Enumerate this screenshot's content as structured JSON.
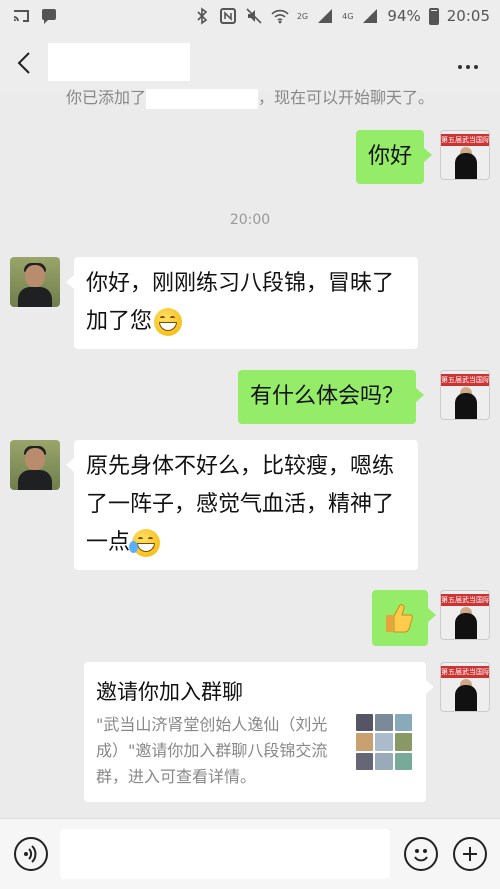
{
  "status_bar": {
    "battery_percent": "94%",
    "time": "20:05",
    "signal_labels": [
      "2G",
      "4G"
    ]
  },
  "header": {
    "back_icon": "chevron-left-icon",
    "more_icon": "ellipsis-icon"
  },
  "system_note": {
    "prefix": "你已添加了",
    "suffix": "，现在可以开始聊天了。"
  },
  "messages": [
    {
      "side": "out",
      "text": "你好"
    },
    {
      "side": "in",
      "text": "你好，刚刚练习八段锦，冒昧了加了您",
      "emoji": "grinning-face"
    },
    {
      "side": "out",
      "text": "有什么体会吗？"
    },
    {
      "side": "in",
      "text": "原先身体不好么，比较瘦，嗯练了一阵子，感觉气血活，精神了一点",
      "emoji": "loudly-crying-face"
    },
    {
      "side": "out",
      "emoji": "thumbs-up"
    }
  ],
  "timestamp": "20:00",
  "avatar_banner": "第五届武当国际演武大",
  "invite_card": {
    "title": "邀请你加入群聊",
    "description": "\"武当山济肾堂创始人逸仙（刘光成）\"邀请你加入群聊八段锦交流群，进入可查看详情。"
  },
  "input_bar": {
    "placeholder": "",
    "voice_icon": "voice-icon",
    "emoji_icon": "smiley-icon",
    "plus_icon": "plus-icon"
  },
  "colors": {
    "out_bubble": "#95ec69",
    "in_bubble": "#ffffff",
    "background": "#ebebeb"
  }
}
